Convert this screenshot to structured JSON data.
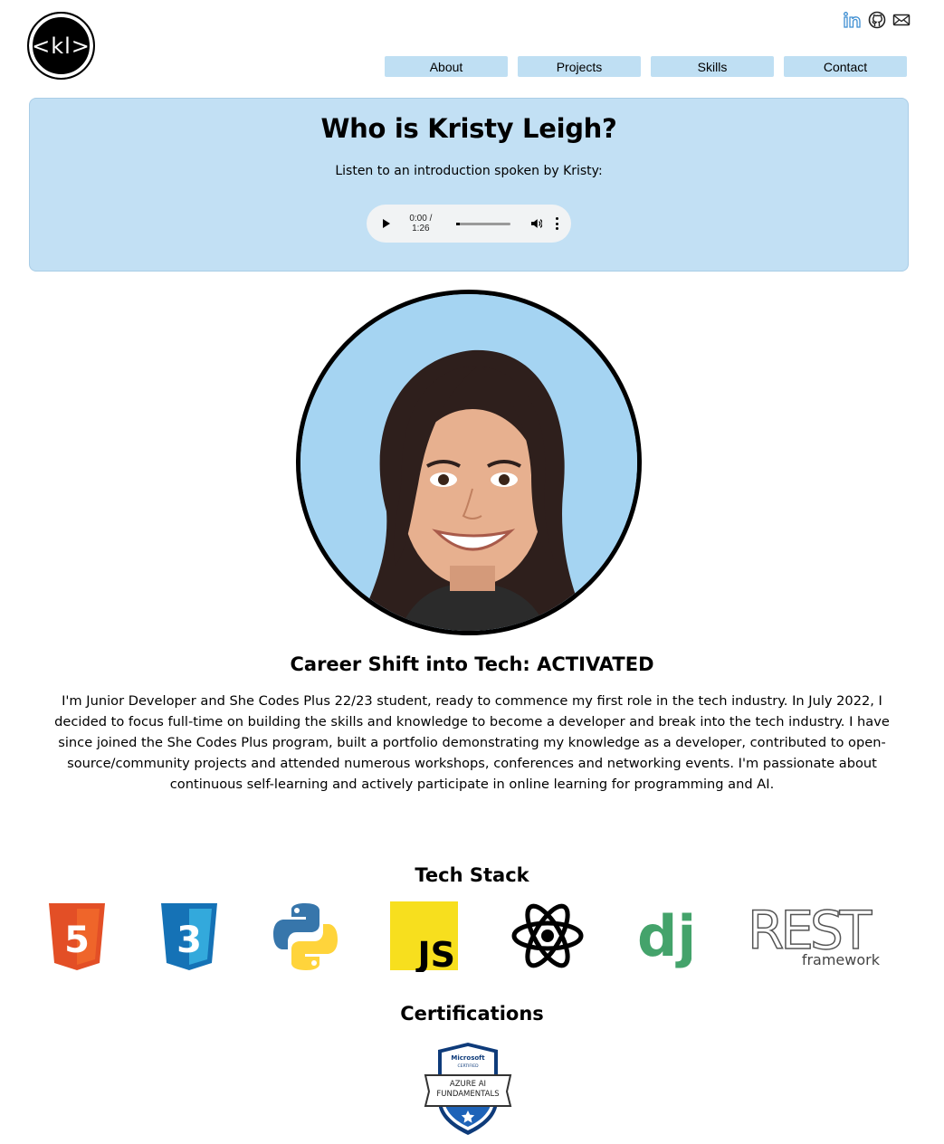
{
  "header": {
    "logo_text": "<kl>",
    "social": [
      "linkedin-icon",
      "github-icon",
      "mail-icon"
    ],
    "nav": [
      "About",
      "Projects",
      "Skills",
      "Contact"
    ]
  },
  "intro": {
    "title": "Who is Kristy Leigh?",
    "subtitle": "Listen to an introduction spoken by Kristy:",
    "audio_time": "0:00 / 1:26"
  },
  "about": {
    "heading": "Career Shift into Tech: ACTIVATED",
    "body": "I'm Junior Developer and She Codes Plus 22/23 student, ready to commence my first role in the tech industry. In July 2022, I decided to focus full-time on building the skills and knowledge to become a developer and break into the tech industry. I have since joined the She Codes Plus program, built a portfolio demonstrating my knowledge as a developer, contributed to open-source/community projects and attended numerous workshops, conferences and networking events. I'm passionate about continuous self-learning and actively participate in online learning for programming and AI."
  },
  "tech_stack": {
    "title": "Tech Stack",
    "items": [
      "html5-logo",
      "css3-logo",
      "python-logo",
      "javascript-logo",
      "react-logo",
      "django-logo",
      "rest-framework-logo"
    ],
    "html5_glyph": "5",
    "css3_glyph": "3",
    "js_text": "JS",
    "django_text": "dj",
    "rest_text": "REST",
    "rest_sub": "framework"
  },
  "certifications": {
    "title": "Certifications",
    "badge_top": "Microsoft",
    "badge_certified": "CERTIFIED",
    "badge_line1": "AZURE AI",
    "badge_line2": "FUNDAMENTALS"
  },
  "colors": {
    "nav_bg": "#bfdff3",
    "intro_bg": "#c2e0f4",
    "avatar_bg": "#a5d4f2",
    "linkedin": "#3f8fd2"
  }
}
